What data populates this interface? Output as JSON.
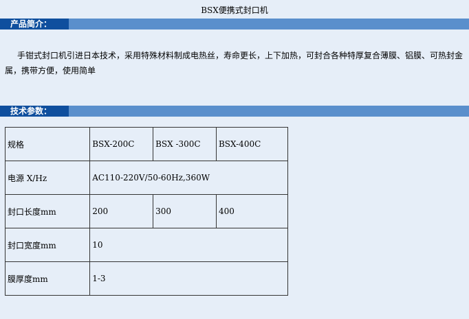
{
  "page": {
    "title": "BSX便携式封口机"
  },
  "intro": {
    "heading": "产品简介：",
    "text": "手钳式封口机引进日本技术，采用特殊材料制成电热丝，寿命更长，上下加热，可封合各种特厚复合薄膜、铝膜、可热封金属，携带方便，使用简单"
  },
  "spec": {
    "heading": "技术参数：",
    "rows": [
      {
        "label": "规格",
        "cells": [
          "BSX-200C",
          "BSX -300C",
          "BSX-400C"
        ]
      },
      {
        "label": "电源  X/Hz",
        "cells": [
          "AC110-220V/50-60Hz,360W"
        ]
      },
      {
        "label": "封口长度mm",
        "cells": [
          "200",
          "300",
          "400"
        ]
      },
      {
        "label": "封口宽度mm",
        "cells": [
          "10"
        ]
      },
      {
        "label": "膜厚度mm",
        "cells": [
          "1-3"
        ]
      }
    ]
  },
  "colors": {
    "bar_light": "#5a8fcc",
    "bar_dark": "#0f4f9e",
    "background": "#e6eef8"
  }
}
